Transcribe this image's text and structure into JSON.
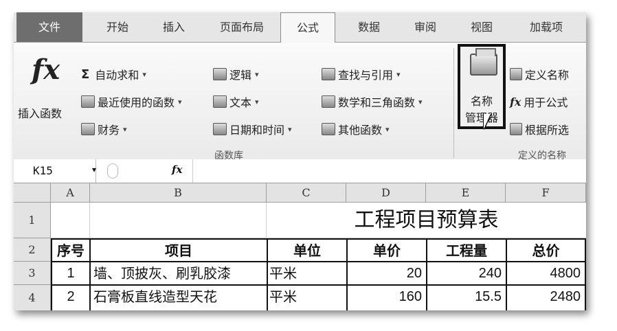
{
  "tabs": [
    "文件",
    "开始",
    "插入",
    "页面布局",
    "公式",
    "数据",
    "审阅",
    "视图",
    "加载项"
  ],
  "active_tab": "公式",
  "ribbon": {
    "insert_function": "插入函数",
    "autosum": "自动求和",
    "recent": "最近使用的函数",
    "finance": "财务",
    "logic": "逻辑",
    "text": "文本",
    "datetime": "日期和时间",
    "lookup": "查找与引用",
    "math": "数学和三角函数",
    "other": "其他函数",
    "group_library": "函数库",
    "name_manager_line1": "名称",
    "name_manager_line2": "管理器",
    "define_name": "定义名称",
    "use_in_formula": "用于公式",
    "create_from_selection": "根据所选",
    "group_defined": "定义的名称"
  },
  "formula_bar": {
    "cell_ref": "K15",
    "fx": "fx",
    "content": ""
  },
  "sheet": {
    "columns": [
      "A",
      "B",
      "C",
      "D",
      "E",
      "F"
    ],
    "rows": [
      "1",
      "2",
      "3",
      "4"
    ],
    "title": "工程项目预算表",
    "headers": [
      "序号",
      "项目",
      "单位",
      "单价",
      "工程量",
      "总价"
    ],
    "data": [
      [
        "1",
        "墙、顶披灰、刷乳胶漆",
        "平米",
        "20",
        "240",
        "4800"
      ],
      [
        "2",
        "石膏板直线造型天花",
        "平米",
        "160",
        "15.5",
        "2480"
      ]
    ]
  }
}
